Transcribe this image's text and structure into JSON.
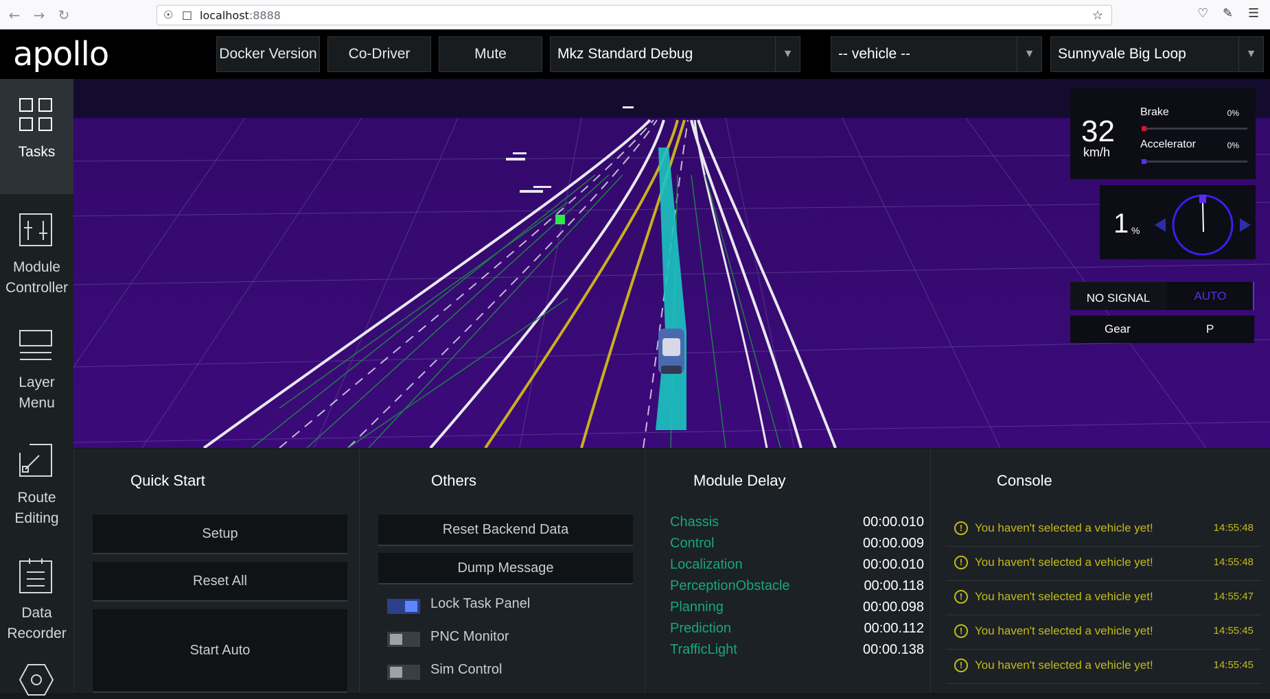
{
  "browser": {
    "url_host": "localhost",
    "url_port": ":8888"
  },
  "header": {
    "logo": "apollo",
    "buttons": [
      {
        "label": "Docker Version"
      },
      {
        "label": "Co-Driver"
      },
      {
        "label": "Mute"
      }
    ],
    "selects": [
      {
        "value": "Mkz Standard Debug"
      },
      {
        "value": "-- vehicle --"
      },
      {
        "value": "Sunnyvale Big Loop"
      }
    ]
  },
  "sidebar": {
    "items": [
      {
        "label_line1": "Tasks",
        "label_line2": ""
      },
      {
        "label_line1": "Module",
        "label_line2": "Controller"
      },
      {
        "label_line1": "Layer",
        "label_line2": "Menu"
      },
      {
        "label_line1": "Route",
        "label_line2": "Editing"
      },
      {
        "label_line1": "Data",
        "label_line2": "Recorder"
      }
    ]
  },
  "dashboard": {
    "speed": "32",
    "speed_unit": "km/h",
    "brake_label": "Brake",
    "brake_pct": "0%",
    "accelerator_label": "Accelerator",
    "accelerator_pct": "0%",
    "steering_pct": "1",
    "steering_unit": "%",
    "signal": "NO SIGNAL",
    "drive_mode": "AUTO",
    "gear_label": "Gear",
    "gear_value": "P",
    "brake_color": "#d7182a",
    "accelerator_color": "#5a2df0"
  },
  "quick_start": {
    "title": "Quick Start",
    "buttons": [
      "Setup",
      "Reset All",
      "Start Auto"
    ]
  },
  "others": {
    "title": "Others",
    "buttons": [
      "Reset Backend Data",
      "Dump Message"
    ],
    "toggles": [
      {
        "label": "Lock Task Panel",
        "on": true
      },
      {
        "label": "PNC Monitor",
        "on": false
      },
      {
        "label": "Sim Control",
        "on": false
      }
    ]
  },
  "module_delay": {
    "title": "Module Delay",
    "rows": [
      {
        "name": "Chassis",
        "value": "00:00.010"
      },
      {
        "name": "Control",
        "value": "00:00.009"
      },
      {
        "name": "Localization",
        "value": "00:00.010"
      },
      {
        "name": "PerceptionObstacle",
        "value": "00:00.118"
      },
      {
        "name": "Planning",
        "value": "00:00.098"
      },
      {
        "name": "Prediction",
        "value": "00:00.112"
      },
      {
        "name": "TrafficLight",
        "value": "00:00.138"
      }
    ]
  },
  "console": {
    "title": "Console",
    "messages": [
      {
        "text": "You haven't selected a vehicle yet!",
        "time": "14:55:48"
      },
      {
        "text": "You haven't selected a vehicle yet!",
        "time": "14:55:48"
      },
      {
        "text": "You haven't selected a vehicle yet!",
        "time": "14:55:47"
      },
      {
        "text": "You haven't selected a vehicle yet!",
        "time": "14:55:45"
      },
      {
        "text": "You haven't selected a vehicle yet!",
        "time": "14:55:45"
      }
    ]
  }
}
